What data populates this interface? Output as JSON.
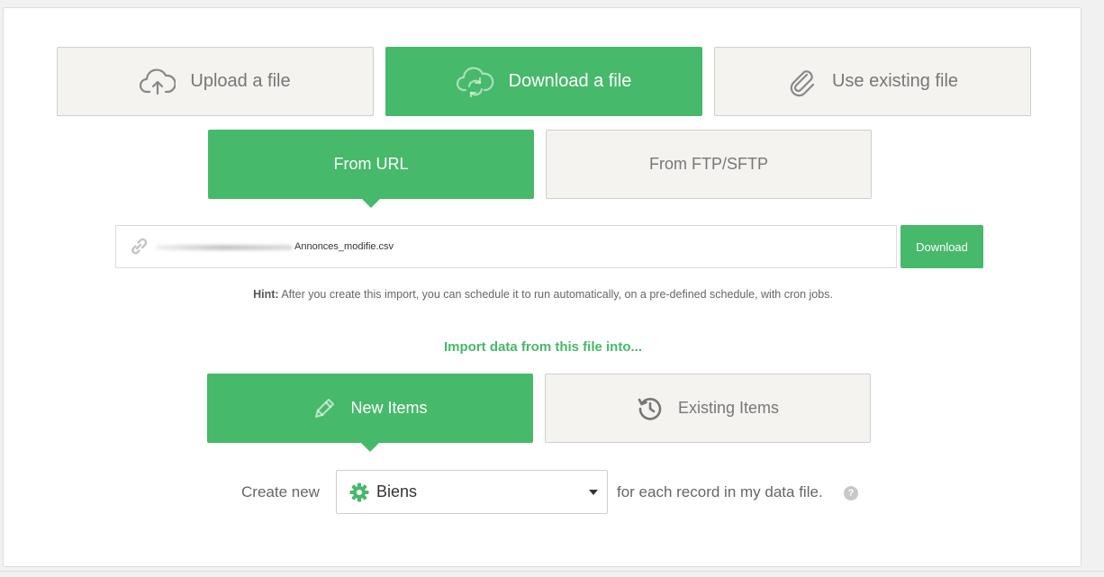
{
  "source_tabs": [
    {
      "label": "Upload a file",
      "icon": "cloud-upload-icon",
      "active": false
    },
    {
      "label": "Download a file",
      "icon": "cloud-sync-icon",
      "active": true
    },
    {
      "label": "Use existing file",
      "icon": "paperclip-icon",
      "active": false
    }
  ],
  "download_tabs": [
    {
      "label": "From URL",
      "active": true
    },
    {
      "label": "From FTP/SFTP",
      "active": false
    }
  ],
  "url_input": {
    "value_visible": "Annonces_modifie.csv",
    "icon": "link-icon",
    "button_label": "Download"
  },
  "hint": {
    "prefix": "Hint:",
    "text": "After you create this import, you can schedule it to run automatically, on a pre-defined schedule, with cron jobs."
  },
  "import_label": "Import data from this file into...",
  "item_tabs": [
    {
      "label": "New Items",
      "icon": "pencil-icon",
      "active": true
    },
    {
      "label": "Existing Items",
      "icon": "history-icon",
      "active": false
    }
  ],
  "create_row": {
    "prefix": "Create new",
    "selected": "Biens",
    "selected_icon": "gear-icon",
    "suffix": "for each record in my data file.",
    "help": "?"
  },
  "colors": {
    "accent": "#46b96a",
    "tab_inactive_bg": "#f4f3f0",
    "text_muted": "#777777"
  }
}
